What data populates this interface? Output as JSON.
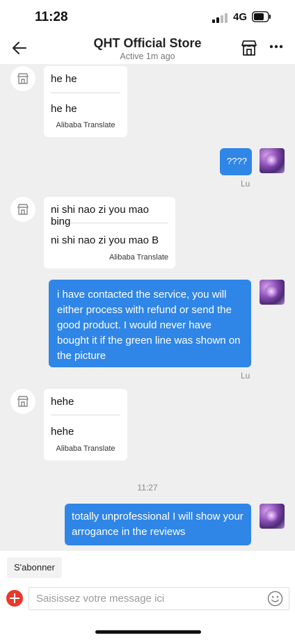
{
  "status_bar": {
    "time": "11:28",
    "network": "4G"
  },
  "header": {
    "title": "QHT Official Store",
    "subtitle": "Active 1m ago"
  },
  "messages": {
    "m1": {
      "text": "he he",
      "translation": "he he",
      "translate_label": "Alibaba Translate"
    },
    "m2": {
      "text": "????",
      "sender": "Lu"
    },
    "m3": {
      "text": "ni shi nao zi you mao bing",
      "translation": "ni shi nao zi you mao B",
      "translate_label": "Alibaba Translate"
    },
    "m4": {
      "text": "i have contacted the service, you will either process with refund or send the good product. I would never have bought it if the green line was shown on the picture",
      "sender": "Lu"
    },
    "m5": {
      "text": "hehe",
      "translation": "hehe",
      "translate_label": "Alibaba Translate"
    },
    "timestamp": "11:27",
    "m6": {
      "text": "totally unprofessional I will show your arrogance in the reviews"
    }
  },
  "bottom": {
    "subscribe_label": "S'abonner",
    "input_placeholder": "Saisissez votre message ici"
  },
  "colors": {
    "accent_blue": "#2f86e6",
    "add_red": "#e9392a",
    "chat_bg": "#efefef"
  },
  "icons": [
    "back-arrow-icon",
    "store-icon",
    "more-icon",
    "add-icon",
    "emoji-icon",
    "signal-icon",
    "battery-icon"
  ]
}
